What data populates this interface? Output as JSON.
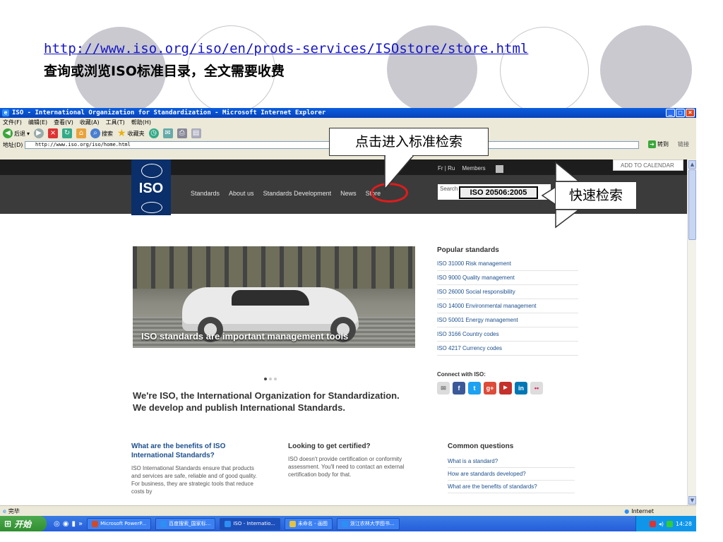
{
  "slide": {
    "url": "http://www.iso.org/iso/en/prods-services/ISOstore/store.html",
    "caption": "查询或浏览ISO标准目录，全文需要收费"
  },
  "window": {
    "title": "ISO - International Organization for Standardization - Microsoft Internet Explorer",
    "controls": {
      "minimize": "_",
      "maximize": "□",
      "close": "×"
    }
  },
  "menu": [
    "文件(F)",
    "编辑(E)",
    "查看(V)",
    "收藏(A)",
    "工具(T)",
    "帮助(H)"
  ],
  "toolbar": {
    "back": "后退",
    "search": "搜索",
    "favorites": "收藏夹"
  },
  "address": {
    "label": "地址(D)",
    "value": "http://www.iso.org/iso/home.html",
    "go": "转到",
    "links": "链接"
  },
  "site": {
    "top_links": {
      "languages": "Fr | Ru",
      "members": "Members"
    },
    "add_to_calendar": "ADD TO CALENDAR",
    "logo": "ISO",
    "nav": [
      "Standards",
      "About us",
      "Standards Development",
      "News",
      "Store"
    ],
    "search_placeholder": "Search",
    "search_value": "ISO 20506:2005",
    "hero_caption": "ISO standards are important management tools",
    "intro": "We're ISO, the International Organization for Standardization. We develop and publish International Standards.",
    "popular": {
      "title": "Popular standards",
      "items": [
        "ISO 31000 Risk management",
        "ISO 9000 Quality management",
        "ISO 26000 Social responsibility",
        "ISO 14000 Environmental management",
        "ISO 50001 Energy management",
        "ISO 3166 Country codes",
        "ISO 4217 Currency codes"
      ]
    },
    "connect": "Connect with ISO:",
    "benefits": {
      "title": "What are the benefits of ISO International Standards?",
      "text": "ISO International Standards ensure that products and services are safe, reliable and of good quality. For business, they are strategic tools that reduce costs by"
    },
    "certified": {
      "title": "Looking to get certified?",
      "text": "ISO doesn't provide certification or conformity assessment. You'll need to contact an external certification body for that."
    },
    "questions": {
      "title": "Common questions",
      "items": [
        "What is a standard?",
        "How are standards developed?",
        "What are the benefits of standards?"
      ]
    }
  },
  "status": {
    "left": "完毕",
    "zone": "Internet"
  },
  "callouts": {
    "store": "点击进入标准检索",
    "quick_search": "快速检索"
  },
  "taskbar": {
    "start": "开始",
    "tasks": [
      "Microsoft PowerP...",
      "百度搜索_国家标...",
      "ISO - Internatio...",
      "未命名 - 画图",
      "浙江农林大学图书..."
    ],
    "clock": "14:28"
  },
  "colors": {
    "link": "#1515c8",
    "iso_blue": "#0a2f6a",
    "highlight_red": "#e21b1b",
    "taskbar": "#245ddb"
  }
}
